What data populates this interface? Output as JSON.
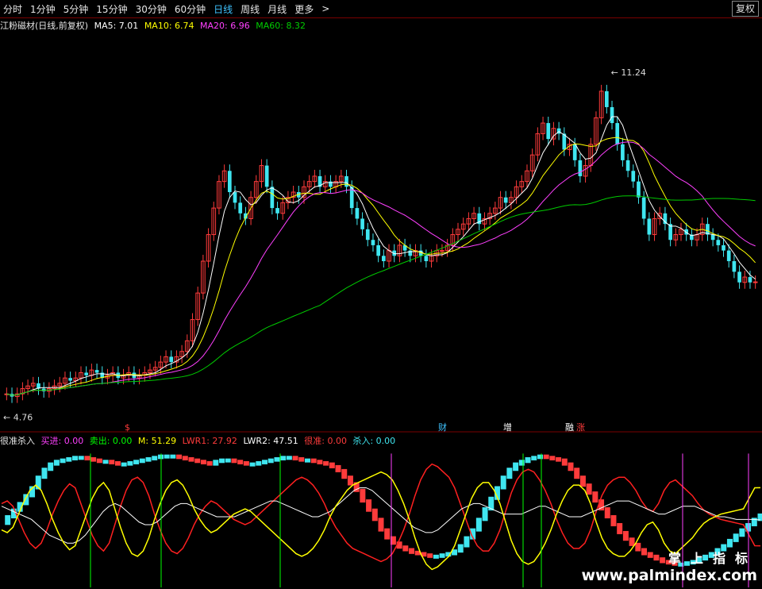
{
  "toolbar": {
    "periods": [
      "分时",
      "1分钟",
      "5分钟",
      "15分钟",
      "30分钟",
      "60分钟",
      "日线",
      "周线",
      "月线",
      "更多"
    ],
    "active": "日线",
    "more_arrow": ">",
    "fuquan": "复权"
  },
  "main_legend": {
    "title": "江粉磁材(日线,前复权)",
    "ma5": "MA5: 7.01",
    "ma10": "MA10: 6.74",
    "ma20": "MA20: 6.96",
    "ma60": "MA60: 8.32"
  },
  "indicator_legend": {
    "name": "很准杀入",
    "buy": "买进: 0.00",
    "sell": "卖出: 0.00",
    "m": "M: 51.29",
    "lwr1": "LWR1: 27.92",
    "lwr2": "LWR2: 47.51",
    "henzhun": "很准: 0.00",
    "shaaru": "杀入: 0.00"
  },
  "markers": [
    "$",
    "财",
    "增",
    "融",
    "涨"
  ],
  "watermark": {
    "line1": "掌上指标",
    "line2": "www.palmindex.com"
  },
  "colors": {
    "up": "#ff3b3b",
    "down": "#3fe6f0",
    "ma5": "#ffffff",
    "ma10": "#ffff00",
    "ma20": "#ff40ff",
    "ma60": "#00cc00"
  },
  "chart_data": {
    "type": "candlestick",
    "low_label": "4.76",
    "high_label": "11.24",
    "ylim": [
      4.5,
      11.6
    ],
    "close": [
      4.9,
      4.85,
      4.9,
      5.0,
      5.05,
      5.1,
      5.0,
      4.95,
      5.0,
      5.05,
      5.1,
      5.2,
      5.15,
      5.2,
      5.3,
      5.25,
      5.35,
      5.3,
      5.2,
      5.25,
      5.3,
      5.2,
      5.25,
      5.3,
      5.2,
      5.25,
      5.3,
      5.35,
      5.4,
      5.5,
      5.6,
      5.5,
      5.6,
      5.7,
      5.9,
      6.3,
      6.8,
      7.4,
      7.9,
      8.4,
      8.9,
      9.1,
      8.7,
      8.5,
      8.3,
      8.2,
      8.6,
      8.9,
      9.2,
      8.8,
      8.4,
      8.3,
      8.5,
      8.6,
      8.7,
      8.6,
      8.8,
      8.9,
      9.0,
      8.8,
      8.9,
      8.8,
      8.9,
      9.0,
      8.8,
      8.4,
      8.2,
      8.0,
      7.8,
      7.7,
      7.5,
      7.4,
      7.6,
      7.5,
      7.7,
      7.6,
      7.5,
      7.6,
      7.5,
      7.4,
      7.5,
      7.6,
      7.6,
      7.7,
      7.9,
      8.0,
      8.1,
      8.2,
      8.3,
      8.1,
      8.2,
      8.3,
      8.4,
      8.6,
      8.5,
      8.6,
      8.8,
      8.9,
      9.1,
      9.4,
      9.8,
      10.0,
      9.7,
      9.9,
      9.8,
      9.5,
      9.6,
      9.3,
      9.0,
      9.2,
      9.6,
      10.1,
      10.6,
      10.3,
      10.0,
      9.6,
      9.3,
      9.1,
      8.9,
      8.6,
      8.2,
      7.9,
      8.2,
      8.3,
      8.1,
      7.8,
      7.9,
      8.0,
      7.9,
      7.8,
      7.9,
      8.1,
      7.9,
      7.8,
      7.7,
      7.6,
      7.4,
      7.2,
      7.0,
      7.1,
      7.0,
      7.01
    ],
    "ma60_series": "ma60",
    "indicator": {
      "series": [
        "M",
        "LWR1",
        "LWR2",
        "买进",
        "卖出"
      ],
      "m": [
        45,
        50,
        55,
        60,
        66,
        72,
        80,
        86,
        90,
        92,
        93,
        94,
        95,
        95,
        94,
        93,
        92,
        92,
        91,
        90,
        90,
        91,
        92,
        93,
        94,
        95,
        96,
        96,
        96,
        95,
        94,
        93,
        92,
        91,
        90,
        92,
        93,
        93,
        92,
        91,
        90,
        90,
        91,
        92,
        93,
        94,
        95,
        95,
        94,
        93,
        93,
        92,
        91,
        90,
        88,
        85,
        80,
        75,
        70,
        62,
        55,
        48,
        40,
        34,
        30,
        27,
        25,
        23,
        22,
        21,
        20,
        20,
        21,
        22,
        24,
        28,
        34,
        40,
        48,
        56,
        64,
        72,
        80,
        86,
        90,
        92,
        94,
        95,
        96,
        95,
        94,
        93,
        90,
        86,
        80,
        74,
        68,
        62,
        56,
        50,
        44,
        38,
        33,
        29,
        25,
        22,
        20,
        18,
        16,
        15,
        14,
        14,
        15,
        16,
        18,
        20,
        22,
        25,
        28,
        32,
        36,
        40,
        44,
        48,
        51.29
      ],
      "lwr1": [
        60,
        62,
        58,
        48,
        38,
        30,
        26,
        30,
        40,
        52,
        62,
        70,
        75,
        72,
        60,
        48,
        36,
        28,
        24,
        30,
        44,
        58,
        70,
        78,
        80,
        76,
        66,
        52,
        40,
        30,
        24,
        22,
        26,
        34,
        44,
        52,
        58,
        62,
        60,
        56,
        52,
        48,
        46,
        44,
        46,
        50,
        54,
        58,
        62,
        66,
        70,
        74,
        78,
        80,
        78,
        74,
        68,
        60,
        50,
        42,
        36,
        30,
        26,
        24,
        22,
        20,
        18,
        16,
        18,
        22,
        30,
        40,
        52,
        66,
        78,
        86,
        90,
        88,
        84,
        80,
        72,
        60,
        48,
        36,
        28,
        24,
        24,
        30,
        40,
        54,
        68,
        78,
        84,
        86,
        84,
        78,
        70,
        60,
        48,
        38,
        30,
        26,
        26,
        30,
        40,
        54,
        66,
        74,
        78,
        80,
        80,
        76,
        70,
        62,
        56,
        54,
        60,
        70,
        76,
        78,
        74,
        70,
        66,
        60,
        55,
        52,
        50,
        48,
        47,
        46,
        45,
        44,
        36,
        28,
        27.92
      ],
      "lwr2": [
        58,
        56,
        54,
        52,
        50,
        48,
        44,
        40,
        36,
        34,
        32,
        30,
        30,
        32,
        36,
        42,
        48,
        54,
        58,
        60,
        58,
        54,
        50,
        46,
        44,
        44,
        46,
        50,
        54,
        58,
        60,
        60,
        58,
        56,
        54,
        52,
        50,
        50,
        50,
        50,
        52,
        54,
        56,
        58,
        60,
        62,
        62,
        60,
        58,
        56,
        54,
        52,
        50,
        50,
        52,
        54,
        58,
        62,
        66,
        70,
        72,
        72,
        70,
        66,
        62,
        58,
        54,
        50,
        46,
        42,
        40,
        38,
        38,
        40,
        44,
        48,
        52,
        56,
        58,
        60,
        60,
        58,
        56,
        54,
        52,
        52,
        52,
        52,
        54,
        56,
        58,
        58,
        56,
        54,
        52,
        50,
        50,
        50,
        52,
        54,
        56,
        58,
        60,
        62,
        62,
        62,
        60,
        58,
        56,
        54,
        52,
        52,
        54,
        56,
        58,
        58,
        58,
        56,
        54,
        52,
        50,
        50,
        49,
        48,
        48,
        48,
        48,
        47.51
      ]
    }
  }
}
